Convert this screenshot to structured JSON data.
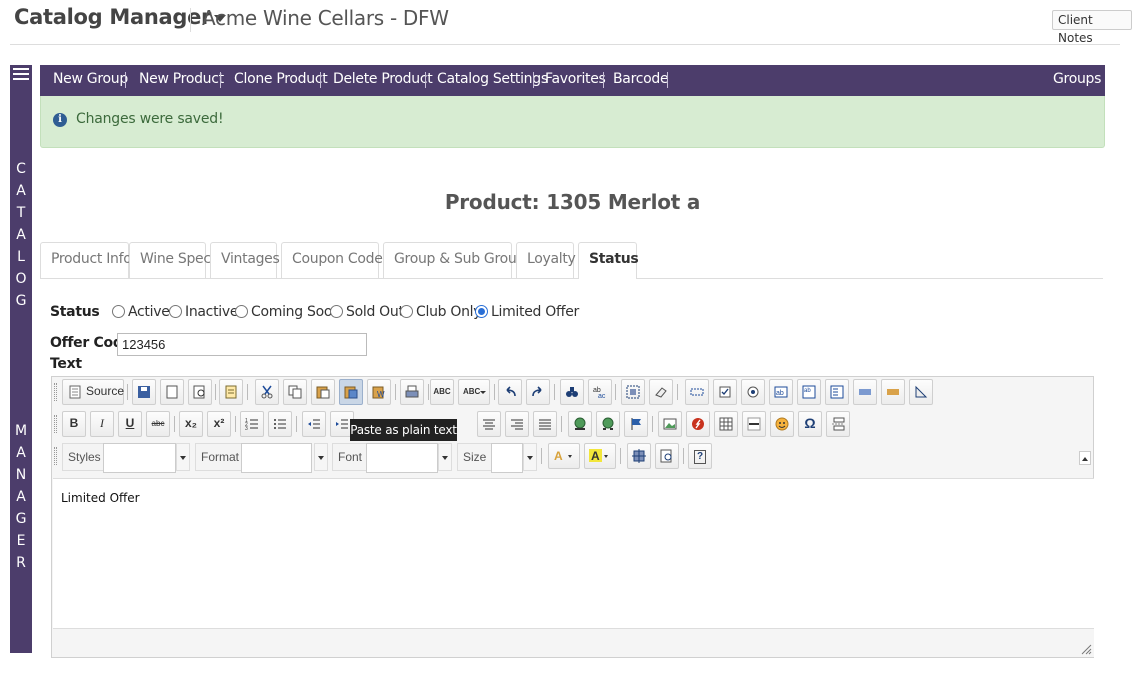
{
  "header": {
    "app_title": "Catalog Manager",
    "store_name": "Acme Wine Cellars - DFW",
    "client_notes": "Client Notes"
  },
  "sidebar": {
    "word1": [
      "C",
      "A",
      "T",
      "A",
      "L",
      "O",
      "G"
    ],
    "word2": [
      "M",
      "A",
      "N",
      "A",
      "G",
      "E",
      "R"
    ]
  },
  "nav": {
    "items": [
      "New Group",
      "New Product",
      "Clone Product",
      "Delete Product",
      "Catalog Settings",
      "Favorites",
      "Barcode"
    ],
    "right": "Groups"
  },
  "alert": {
    "message": "Changes were saved!"
  },
  "product_title": "Product: 1305 Merlot a",
  "tabs": [
    "Product Info",
    "Wine Spec",
    "Vintages",
    "Coupon Codes",
    "Group & Sub Groups",
    "Loyalty",
    "Status"
  ],
  "active_tab": "Status",
  "status": {
    "label": "Status",
    "options": [
      "Active",
      "Inactive",
      "Coming Soon",
      "Sold Out",
      "Club Only",
      "Limited Offer"
    ],
    "selected": "Limited Offer"
  },
  "offer_code": {
    "label": "Offer Code:",
    "value": "123456"
  },
  "text_label": "Text",
  "editor": {
    "source_label": "Source",
    "styles_label": "Styles",
    "format_label": "Format",
    "font_label": "Font",
    "size_label": "Size",
    "tooltip": "Paste as plain text",
    "content": "Limited Offer",
    "glyphs": {
      "bold": "B",
      "italic": "I",
      "underline": "U",
      "strike": "abc",
      "subscript": "x₂",
      "superscript": "x²",
      "omega": "Ω",
      "help": "?",
      "spell1": "ABC",
      "spell2": "ABC"
    }
  },
  "colors": {
    "brand_purple": "#4c3d6b",
    "alert_bg": "#d7ecd2",
    "alert_text": "#3c6a3c",
    "radio_selected": "#2a6fd6"
  }
}
